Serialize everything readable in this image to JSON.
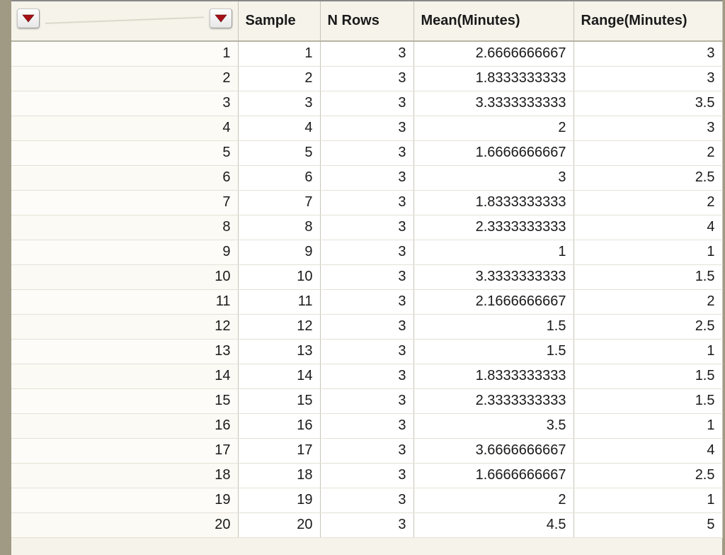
{
  "columns": {
    "sample": "Sample",
    "nRows": "N Rows",
    "mean": "Mean(Minutes)",
    "range": "Range(Minutes)"
  },
  "rows": [
    {
      "idx": "1",
      "sample": "1",
      "nRows": "3",
      "mean": "2.6666666667",
      "range": "3"
    },
    {
      "idx": "2",
      "sample": "2",
      "nRows": "3",
      "mean": "1.8333333333",
      "range": "3"
    },
    {
      "idx": "3",
      "sample": "3",
      "nRows": "3",
      "mean": "3.3333333333",
      "range": "3.5"
    },
    {
      "idx": "4",
      "sample": "4",
      "nRows": "3",
      "mean": "2",
      "range": "3"
    },
    {
      "idx": "5",
      "sample": "5",
      "nRows": "3",
      "mean": "1.6666666667",
      "range": "2"
    },
    {
      "idx": "6",
      "sample": "6",
      "nRows": "3",
      "mean": "3",
      "range": "2.5"
    },
    {
      "idx": "7",
      "sample": "7",
      "nRows": "3",
      "mean": "1.8333333333",
      "range": "2"
    },
    {
      "idx": "8",
      "sample": "8",
      "nRows": "3",
      "mean": "2.3333333333",
      "range": "4"
    },
    {
      "idx": "9",
      "sample": "9",
      "nRows": "3",
      "mean": "1",
      "range": "1"
    },
    {
      "idx": "10",
      "sample": "10",
      "nRows": "3",
      "mean": "3.3333333333",
      "range": "1.5"
    },
    {
      "idx": "11",
      "sample": "11",
      "nRows": "3",
      "mean": "2.1666666667",
      "range": "2"
    },
    {
      "idx": "12",
      "sample": "12",
      "nRows": "3",
      "mean": "1.5",
      "range": "2.5"
    },
    {
      "idx": "13",
      "sample": "13",
      "nRows": "3",
      "mean": "1.5",
      "range": "1"
    },
    {
      "idx": "14",
      "sample": "14",
      "nRows": "3",
      "mean": "1.8333333333",
      "range": "1.5"
    },
    {
      "idx": "15",
      "sample": "15",
      "nRows": "3",
      "mean": "2.3333333333",
      "range": "1.5"
    },
    {
      "idx": "16",
      "sample": "16",
      "nRows": "3",
      "mean": "3.5",
      "range": "1"
    },
    {
      "idx": "17",
      "sample": "17",
      "nRows": "3",
      "mean": "3.6666666667",
      "range": "4"
    },
    {
      "idx": "18",
      "sample": "18",
      "nRows": "3",
      "mean": "1.6666666667",
      "range": "2.5"
    },
    {
      "idx": "19",
      "sample": "19",
      "nRows": "3",
      "mean": "2",
      "range": "1"
    },
    {
      "idx": "20",
      "sample": "20",
      "nRows": "3",
      "mean": "4.5",
      "range": "5"
    }
  ],
  "chart_data": {
    "type": "table",
    "title": "",
    "columns": [
      "Sample",
      "N Rows",
      "Mean(Minutes)",
      "Range(Minutes)"
    ],
    "data": [
      [
        1,
        3,
        2.6666666667,
        3
      ],
      [
        2,
        3,
        1.8333333333,
        3
      ],
      [
        3,
        3,
        3.3333333333,
        3.5
      ],
      [
        4,
        3,
        2,
        3
      ],
      [
        5,
        3,
        1.6666666667,
        2
      ],
      [
        6,
        3,
        3,
        2.5
      ],
      [
        7,
        3,
        1.8333333333,
        2
      ],
      [
        8,
        3,
        2.3333333333,
        4
      ],
      [
        9,
        3,
        1,
        1
      ],
      [
        10,
        3,
        3.3333333333,
        1.5
      ],
      [
        11,
        3,
        2.1666666667,
        2
      ],
      [
        12,
        3,
        1.5,
        2.5
      ],
      [
        13,
        3,
        1.5,
        1
      ],
      [
        14,
        3,
        1.8333333333,
        1.5
      ],
      [
        15,
        3,
        2.3333333333,
        1.5
      ],
      [
        16,
        3,
        3.5,
        1
      ],
      [
        17,
        3,
        3.6666666667,
        4
      ],
      [
        18,
        3,
        1.6666666667,
        2.5
      ],
      [
        19,
        3,
        2,
        1
      ],
      [
        20,
        3,
        4.5,
        5
      ]
    ]
  }
}
